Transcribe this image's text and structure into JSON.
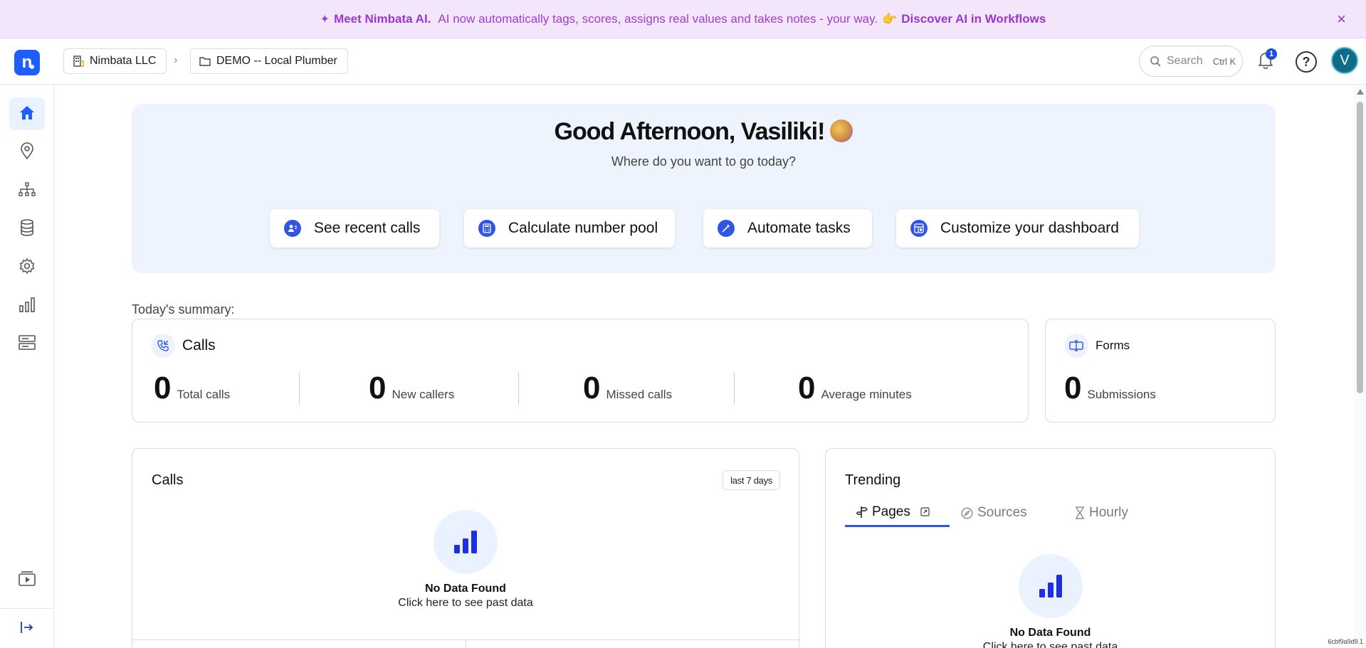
{
  "banner": {
    "title": "Meet Nimbata AI.",
    "text": "AI now automatically tags, scores, assigns real values and takes notes - your way.",
    "emoji": "👉",
    "link": "Discover AI in Workflows",
    "close": "×"
  },
  "header": {
    "logo": "n",
    "breadcrumb": [
      {
        "label": "Nimbata LLC",
        "icon": "building-icon"
      },
      {
        "label": "DEMO -- Local Plumber",
        "icon": "folder-icon"
      }
    ],
    "breadcrumb_sep": "›",
    "search_placeholder": "Search",
    "search_shortcut": "Ctrl K",
    "notifications_count": "1",
    "help": "?",
    "avatar_initial": "V"
  },
  "sidebar": {
    "items": [
      {
        "name": "home",
        "icon": "home-icon",
        "active": true
      },
      {
        "name": "locations",
        "icon": "map-pin-icon"
      },
      {
        "name": "hierarchy",
        "icon": "sitemap-icon"
      },
      {
        "name": "data",
        "icon": "database-icon"
      },
      {
        "name": "settings",
        "icon": "gear-icon"
      },
      {
        "name": "reports",
        "icon": "bar-chart-icon"
      },
      {
        "name": "integrations",
        "icon": "cards-icon"
      },
      {
        "name": "tutorials",
        "icon": "video-icon"
      },
      {
        "name": "expand",
        "icon": "expand-arrow-icon"
      }
    ]
  },
  "hero": {
    "title": "Good Afternoon, Vasiliki!",
    "subtitle": "Where do you want to go today?",
    "actions": [
      {
        "label": "See recent calls",
        "icon": "contact-icon"
      },
      {
        "label": "Calculate number pool",
        "icon": "calculator-icon"
      },
      {
        "label": "Automate tasks",
        "icon": "magic-wand-icon"
      },
      {
        "label": "Customize your dashboard",
        "icon": "layout-icon"
      }
    ]
  },
  "summary": {
    "label": "Today's summary:",
    "calls": {
      "title": "Calls",
      "stats": [
        {
          "value": "0",
          "label": "Total calls"
        },
        {
          "value": "0",
          "label": "New callers"
        },
        {
          "value": "0",
          "label": "Missed calls"
        },
        {
          "value": "0",
          "label": "Average minutes"
        }
      ]
    },
    "forms": {
      "title": "Forms",
      "stats": [
        {
          "value": "0",
          "label": "Submissions"
        }
      ]
    }
  },
  "calls_chart": {
    "title": "Calls",
    "range": "last 7 days",
    "empty_title": "No Data Found",
    "empty_sub": "Click here to see past data"
  },
  "trending": {
    "title": "Trending",
    "tabs": [
      {
        "label": "Pages",
        "icon": "signpost-icon",
        "active": true
      },
      {
        "label": "Sources",
        "icon": "compass-icon"
      },
      {
        "label": "Hourly",
        "icon": "hourglass-icon"
      }
    ],
    "empty_title": "No Data Found",
    "empty_sub": "Click here to see past data"
  },
  "footer_id": "6cbf9a9d9.1",
  "colors": {
    "brand": "#1e5eff",
    "accent": "#2f55e5",
    "banner_bg": "#f3e6fb",
    "banner_text": "#9b36d1",
    "hero_bg": "#eef4fd"
  }
}
